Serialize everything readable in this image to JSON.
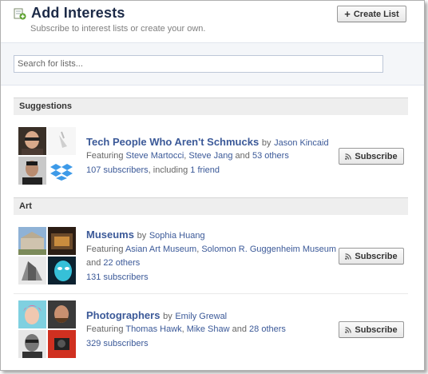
{
  "header": {
    "title": "Add Interests",
    "subtitle": "Subscribe to interest lists or create your own.",
    "create_label": "Create List"
  },
  "search": {
    "placeholder": "Search for lists..."
  },
  "sections": [
    {
      "title": "Suggestions",
      "items": [
        {
          "name": "Tech People Who Aren't Schmucks",
          "by": "by",
          "author": "Jason Kincaid",
          "featuring": "Featuring",
          "people": [
            "Steve Martocci",
            "Steve Jang"
          ],
          "sep": ",",
          "and": "and",
          "others": "53 others",
          "subscribers": "107 subscribers",
          "including": ", including",
          "friend": "1 friend",
          "button": "Subscribe"
        }
      ]
    },
    {
      "title": "Art",
      "items": [
        {
          "name": "Museums",
          "by": "by",
          "author": "Sophia Huang",
          "featuring": "Featuring",
          "people": [
            "Asian Art Museum",
            "Solomon R. Guggenheim Museum"
          ],
          "sep": ",",
          "and": "and",
          "others": "22 others",
          "subscribers": "131 subscribers",
          "button": "Subscribe"
        },
        {
          "name": "Photographers",
          "by": "by",
          "author": "Emily Grewal",
          "featuring": "Featuring",
          "people": [
            "Thomas Hawk",
            "Mike Shaw"
          ],
          "sep": ",",
          "and": "and",
          "others": "28 others",
          "subscribers": "329 subscribers",
          "button": "Subscribe"
        }
      ]
    }
  ],
  "colors": {
    "link": "#3b5998",
    "title": "#1c2a47",
    "section_bg": "#eeeeee"
  },
  "icons": {
    "header": "add-list-icon",
    "create": "plus-icon",
    "subscribe": "rss-icon"
  }
}
